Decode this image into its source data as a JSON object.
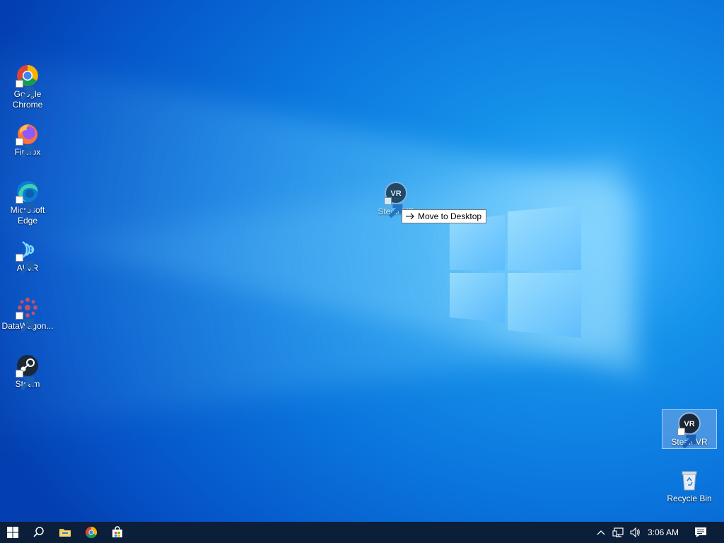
{
  "desktop": {
    "icons": [
      {
        "label": "Google Chrome",
        "name": "google-chrome"
      },
      {
        "label": "Firefox",
        "name": "firefox"
      },
      {
        "label": "Microsoft Edge",
        "name": "microsoft-edge"
      },
      {
        "label": "ALVR",
        "name": "alvr"
      },
      {
        "label": "DataWagon...",
        "name": "datawagon"
      },
      {
        "label": "Steam",
        "name": "steam"
      },
      {
        "label": "SteamVR",
        "name": "steamvr"
      },
      {
        "label": "Recycle Bin",
        "name": "recycle-bin"
      }
    ],
    "dragging": {
      "label": "SteamVR",
      "tooltip": "Move to Desktop"
    }
  },
  "taskbar": {
    "clock": "3:06 AM",
    "pinned": [
      "start-icon",
      "search-icon",
      "file-explorer-icon",
      "chrome-icon",
      "store-icon"
    ],
    "tray": [
      "chevron-up-icon",
      "network-icon",
      "volume-icon",
      "notifications-icon"
    ]
  },
  "colors": {
    "taskbar": "#0b1e3a",
    "selection": "#78aae6"
  }
}
